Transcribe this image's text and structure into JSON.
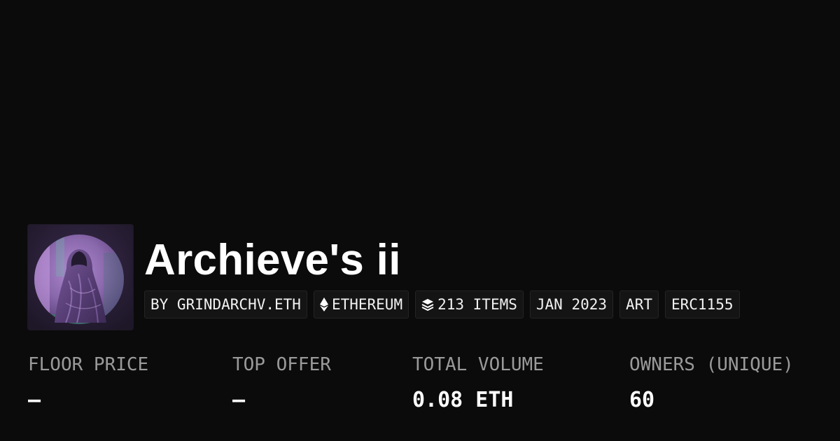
{
  "collection": {
    "name": "Archieve's ii"
  },
  "tags": [
    {
      "label": "BY GRINDARCHV.ETH",
      "icon": ""
    },
    {
      "label": "ETHEREUM",
      "icon": "ethereum-icon"
    },
    {
      "label": "213 ITEMS",
      "icon": "layers-icon"
    },
    {
      "label": "JAN 2023",
      "icon": ""
    },
    {
      "label": "ART",
      "icon": ""
    },
    {
      "label": "ERC1155",
      "icon": ""
    }
  ],
  "stats": [
    {
      "label": "FLOOR PRICE",
      "value": "–"
    },
    {
      "label": "TOP OFFER",
      "value": "–"
    },
    {
      "label": "TOTAL VOLUME",
      "value": "0.08 ETH"
    },
    {
      "label": "OWNERS (UNIQUE)",
      "value": "60"
    }
  ],
  "colors": {
    "background": "#0b0b0b",
    "tag_background": "#141414",
    "label_gray": "#9a9a9a",
    "thumbnail_purple": "#8a6ab0"
  }
}
